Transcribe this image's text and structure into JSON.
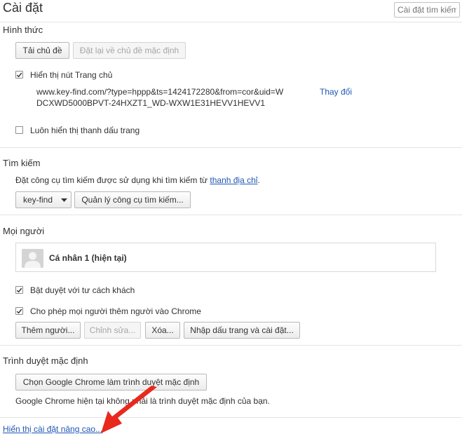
{
  "header": {
    "title": "Cài đặt",
    "search_placeholder": "Cài đặt tìm kiếm"
  },
  "appearance": {
    "title": "Hình thức",
    "get_themes": "Tải chủ đề",
    "reset_theme": "Đặt lại về chủ đề mặc định",
    "show_home_button": "Hiển thị nút Trang chủ",
    "home_url": "www.key-find.com/?type=hppp&ts=1424172280&from=cor&uid=WDCXWD5000BPVT-24HXZT1_WD-WXW1E31HEVV1HEVV1",
    "change_link": "Thay đổi",
    "show_bookmarks_bar": "Luôn hiển thị thanh dấu trang"
  },
  "search": {
    "title": "Tìm kiếm",
    "description_prefix": "Đặt công cụ tìm kiếm được sử dụng khi tìm kiếm từ ",
    "description_link": "thanh địa chỉ",
    "description_suffix": ".",
    "engine_selected": "key-find",
    "manage_engines": "Quản lý công cụ tìm kiếm..."
  },
  "people": {
    "title": "Mọi người",
    "profile_name": "Cá nhân 1 (hiện tại)",
    "guest_browsing": "Bật duyệt với tư cách khách",
    "allow_add_person": "Cho phép mọi người thêm người vào Chrome",
    "add_person": "Thêm người...",
    "edit": "Chỉnh sửa...",
    "remove": "Xóa...",
    "import": "Nhập dấu trang và cài đặt..."
  },
  "default_browser": {
    "title": "Trình duyệt mặc định",
    "make_default": "Chọn Google Chrome làm trình duyệt mặc định",
    "status": "Google Chrome hiện tại không phải là trình duyệt mặc định của bạn."
  },
  "footer": {
    "advanced_link": "Hiển thị cài đặt nâng cao..."
  },
  "colors": {
    "link": "#1f57b5",
    "arrow": "#e8291c"
  },
  "icons": [
    "checkmark-icon",
    "dropdown-arrow-icon",
    "avatar-icon",
    "red-arrow-icon"
  ]
}
